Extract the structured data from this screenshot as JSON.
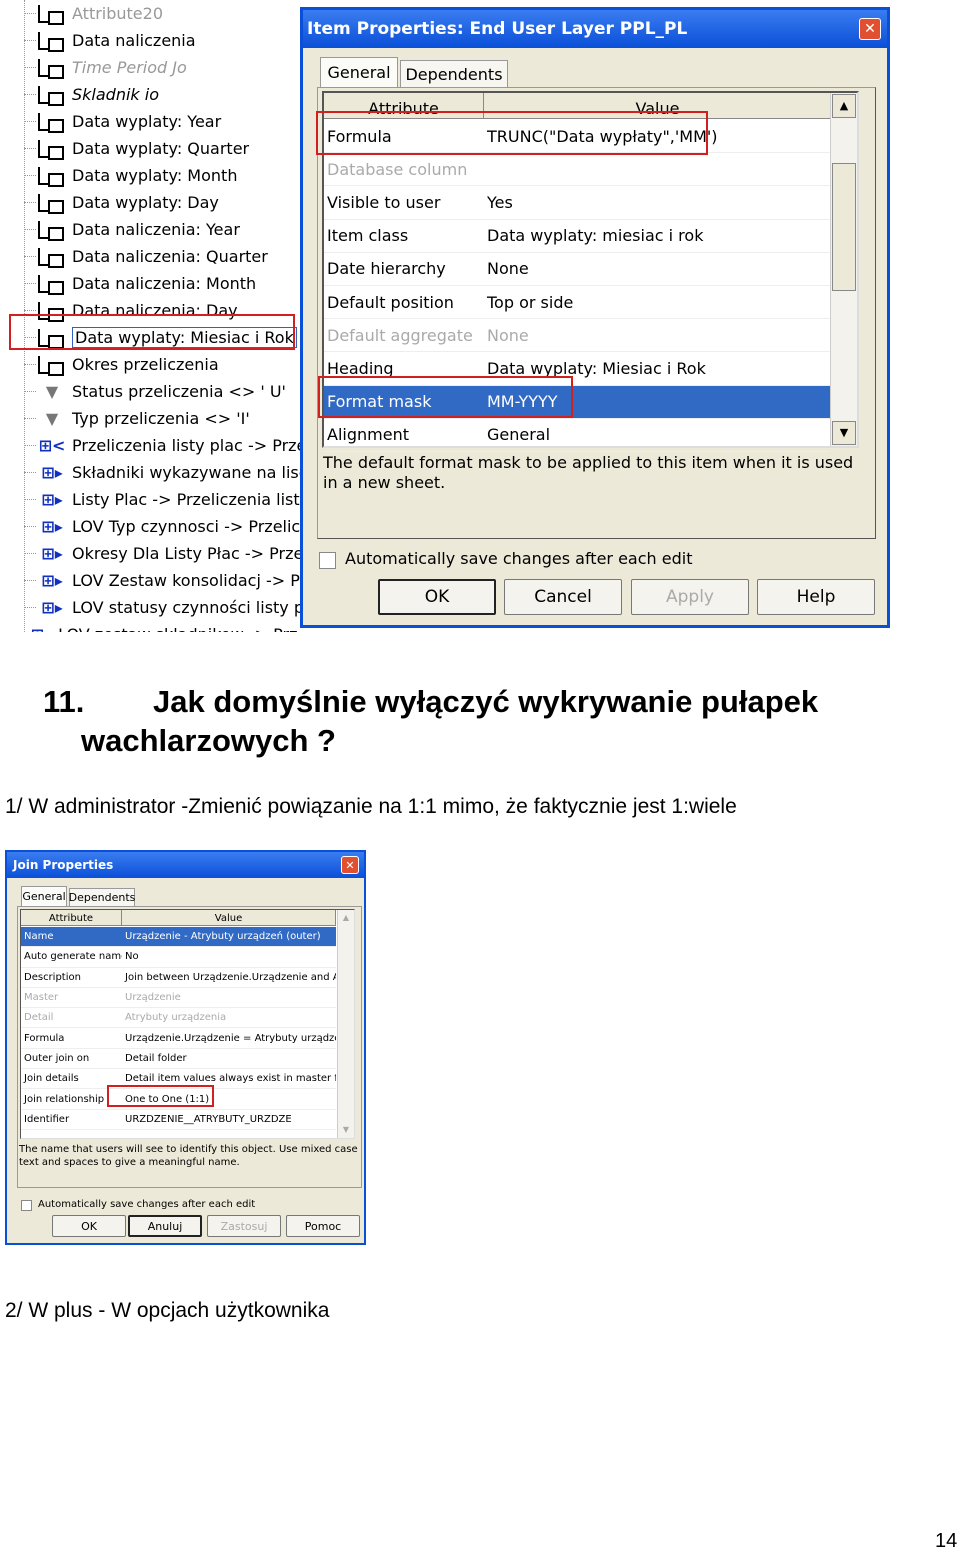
{
  "tree": {
    "items": [
      {
        "label": "Attribute20",
        "icon": "item-icon",
        "style": "dim"
      },
      {
        "label": "Data naliczenia",
        "icon": "item-icon"
      },
      {
        "label": "Time Period Jo",
        "icon": "item-icon",
        "style": "dim ital"
      },
      {
        "label": "Skladnik io",
        "icon": "item-icon",
        "style": "ital"
      },
      {
        "label": "Data wyplaty: Year",
        "icon": "item-icon"
      },
      {
        "label": "Data wyplaty: Quarter",
        "icon": "item-icon"
      },
      {
        "label": "Data wyplaty: Month",
        "icon": "item-icon"
      },
      {
        "label": "Data wyplaty: Day",
        "icon": "item-icon"
      },
      {
        "label": "Data naliczenia: Year",
        "icon": "item-icon"
      },
      {
        "label": "Data naliczenia: Quarter",
        "icon": "item-icon"
      },
      {
        "label": "Data naliczenia: Month",
        "icon": "item-icon"
      },
      {
        "label": "Data naliczenia: Day",
        "icon": "item-icon"
      },
      {
        "label": "Data wyplaty: Miesiac i Rok",
        "icon": "item-icon",
        "style": "sel"
      },
      {
        "label": "Okres przeliczenia",
        "icon": "item-icon"
      },
      {
        "label": "Status przeliczenia <> ' U'",
        "icon": "filter-icon"
      },
      {
        "label": "Typ przeliczenia <> 'I'",
        "icon": "filter-icon"
      },
      {
        "label": "Przeliczenia listy plac -> Przeliczenia",
        "icon": "join-in-icon"
      },
      {
        "label": "Składniki wykazywane na liscie",
        "icon": "join-icon"
      },
      {
        "label": "Listy Plac -> Przeliczenia listy plac",
        "icon": "join-icon"
      },
      {
        "label": "LOV Typ czynnosci -> Przeliczenia",
        "icon": "join-icon"
      },
      {
        "label": "Okresy Dla Listy Płac -> Przeliczenia",
        "icon": "join-icon"
      },
      {
        "label": "LOV Zestaw konsolidacj -> Przeliczenia",
        "icon": "join-icon"
      },
      {
        "label": "LOV statusy czynności listy płac",
        "icon": "join-icon"
      },
      {
        "label": "LOV zestaw skladnikow -> Przeliczenia listy plac",
        "icon": "join-icon"
      }
    ]
  },
  "item_dialog": {
    "title": "Item Properties: End User Layer  PPL_PL",
    "tabs": [
      "General",
      "Dependents"
    ],
    "columns": [
      "Attribute",
      "Value"
    ],
    "rows": [
      {
        "a": "Formula",
        "v": "TRUNC(\"Data wypłaty\",'MM')"
      },
      {
        "a": "Database column",
        "v": "",
        "style": "dim"
      },
      {
        "a": "Visible to user",
        "v": "Yes"
      },
      {
        "a": "Item class",
        "v": "Data wyplaty: miesiac i rok"
      },
      {
        "a": "Date hierarchy",
        "v": "None"
      },
      {
        "a": "Default position",
        "v": "Top or side"
      },
      {
        "a": "Default aggregate",
        "v": "None",
        "style": "dim"
      },
      {
        "a": "Heading",
        "v": "Data wyplaty: Miesiac i Rok"
      },
      {
        "a": "Format mask",
        "v": "MM-YYYY",
        "style": "sel"
      },
      {
        "a": "Alignment",
        "v": "General"
      }
    ],
    "description": "The default format mask to be applied to this item when it is used in a new sheet.",
    "autosave": "Automatically save changes after each edit",
    "buttons": {
      "ok": "OK",
      "cancel": "Cancel",
      "apply": "Apply",
      "help": "Help"
    }
  },
  "heading": {
    "number": "11.",
    "line1": "Jak domyślnie wyłączyć wykrywanie pułapek",
    "line2": "wachlarzowych ?"
  },
  "para1": "1/ W administrator -Zmienić powiązanie na 1:1 mimo, że faktycznie jest 1:wiele",
  "join_dialog": {
    "title": "Join Properties",
    "tabs": [
      "General",
      "Dependents"
    ],
    "columns": [
      "Attribute",
      "Value"
    ],
    "rows": [
      {
        "a": "Name",
        "v": "Urządzenie - Atrybuty urządzeń (outer)",
        "style": "sel"
      },
      {
        "a": "Auto generate name",
        "v": "No"
      },
      {
        "a": "Description",
        "v": "Join between Urządzenie.Urządzenie and Atrybuty"
      },
      {
        "a": "Master",
        "v": "Urządzenie",
        "style": "dim"
      },
      {
        "a": "Detail",
        "v": "Atrybuty urządzenia",
        "style": "dim"
      },
      {
        "a": "Formula",
        "v": "Urządzenie.Urządzenie = Atrybuty urządzenia"
      },
      {
        "a": "Outer join on",
        "v": "Detail folder"
      },
      {
        "a": "Join details",
        "v": "Detail item values always exist in master folder"
      },
      {
        "a": "Join relationship",
        "v": "One to One (1:1)"
      },
      {
        "a": "Identifier",
        "v": "URZDZENIE__ATRYBUTY_URZDZE"
      }
    ],
    "description": "The name that users will see to identify this object. Use mixed case text and spaces to give a meaningful name.",
    "autosave": "Automatically save changes after each edit",
    "buttons": {
      "ok": "OK",
      "cancel": "Anuluj",
      "apply": "Zastosuj",
      "help": "Pomoc"
    }
  },
  "para2": "2/ W plus - W opcjach użytkownika",
  "page_number": "14",
  "colors": {
    "titlebar": "#0a50d8",
    "selection": "#316ac5",
    "highlight_box": "#d02020"
  }
}
